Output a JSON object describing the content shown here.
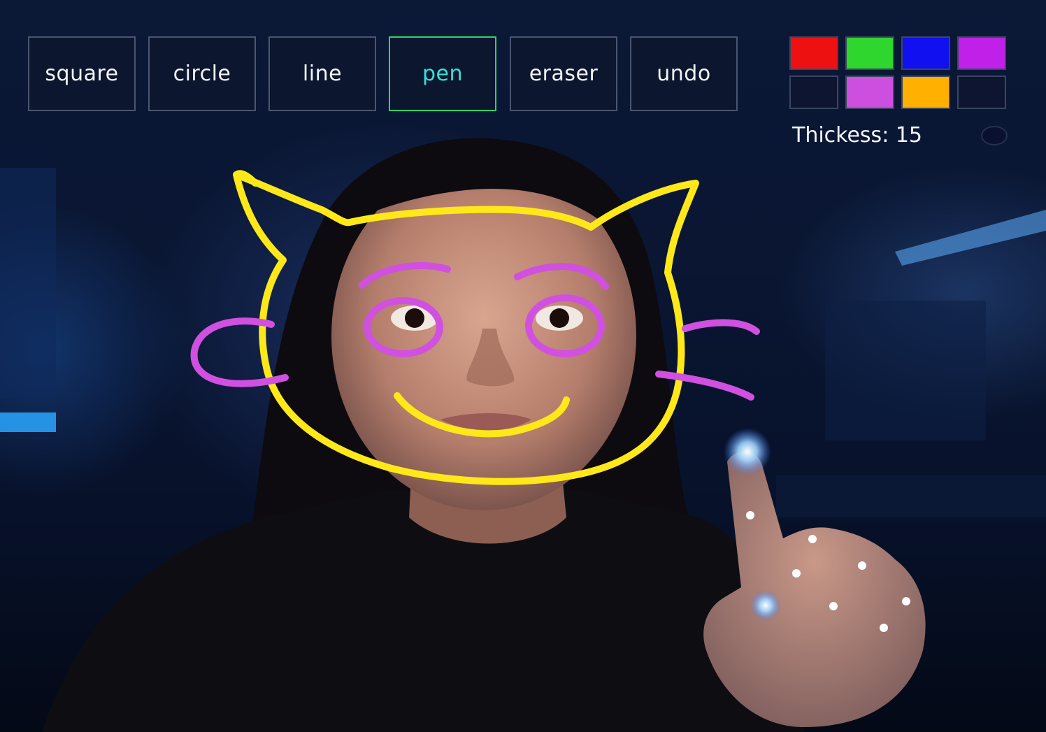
{
  "toolbar": {
    "tools": [
      {
        "id": "square",
        "label": "square",
        "active": false
      },
      {
        "id": "circle",
        "label": "circle",
        "active": false
      },
      {
        "id": "line",
        "label": "line",
        "active": false
      },
      {
        "id": "pen",
        "label": "pen",
        "active": true
      },
      {
        "id": "eraser",
        "label": "eraser",
        "active": false
      },
      {
        "id": "undo",
        "label": "undo",
        "active": false
      }
    ]
  },
  "palette": {
    "colors": [
      "#ee1111",
      "#2ed62e",
      "#1010f0",
      "#c020e8",
      "#0d1530",
      "#cc4fe0",
      "#ffb000",
      "#0d1530"
    ]
  },
  "thickness": {
    "label": "Thickess: 15",
    "value": 15
  },
  "drawing": {
    "stroke_colors": {
      "outline": "#ffe81a",
      "features": "#d050e0"
    }
  }
}
